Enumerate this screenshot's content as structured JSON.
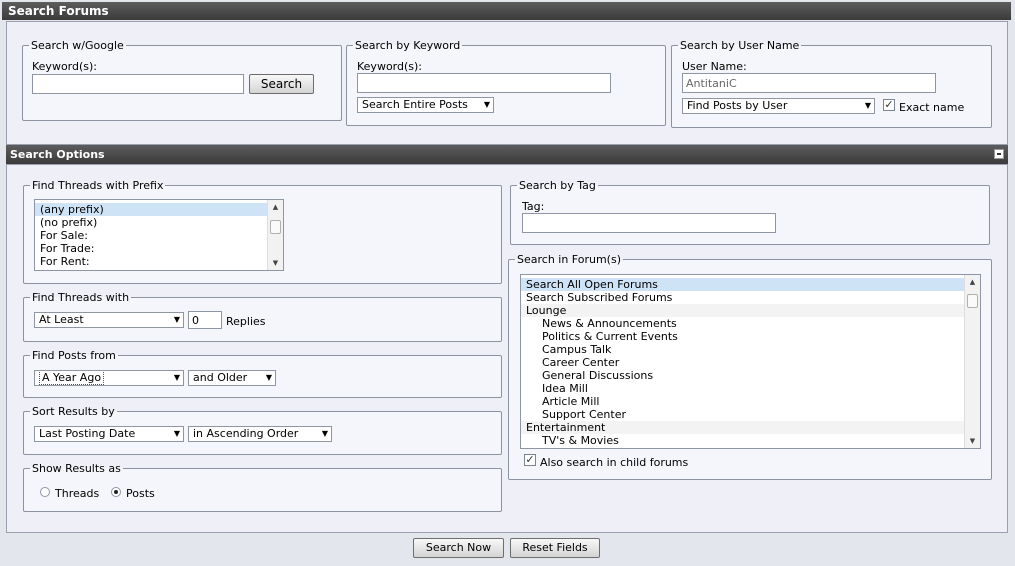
{
  "title": "Search Forums",
  "google": {
    "legend": "Search w/Google",
    "keyword_label": "Keyword(s):",
    "keyword_value": "",
    "search_button": "Search"
  },
  "keyword": {
    "legend": "Search by Keyword",
    "keyword_label": "Keyword(s):",
    "keyword_value": "",
    "scope_select": "Search Entire Posts"
  },
  "username": {
    "legend": "Search by User Name",
    "label": "User Name:",
    "value": "AntitaniC",
    "mode_select": "Find Posts by User",
    "exact_label": "Exact name",
    "exact_checked": true
  },
  "options_title": "Search Options",
  "prefix": {
    "legend": "Find Threads with Prefix",
    "items": [
      "(any prefix)",
      "(no prefix)",
      "For Sale:",
      "For Trade:",
      "For Rent:"
    ]
  },
  "threads_with": {
    "legend": "Find Threads with",
    "select": "At Least",
    "value": "0",
    "suffix": "Replies"
  },
  "posts_from": {
    "legend": "Find Posts from",
    "select": "A Year Ago",
    "age_select": "and Older"
  },
  "sort": {
    "legend": "Sort Results by",
    "field_select": "Last Posting Date",
    "order_select": "in Ascending Order"
  },
  "show_as": {
    "legend": "Show Results as",
    "threads_label": "Threads",
    "posts_label": "Posts",
    "selected": "Posts"
  },
  "tag": {
    "legend": "Search by Tag",
    "label": "Tag:",
    "value": ""
  },
  "forums": {
    "legend": "Search in Forum(s)",
    "items": [
      {
        "label": "Search All Open Forums",
        "indent": false,
        "selected": true
      },
      {
        "label": "Search Subscribed Forums",
        "indent": false
      },
      {
        "label": "Lounge",
        "indent": false
      },
      {
        "label": "News & Announcements",
        "indent": true
      },
      {
        "label": "Politics & Current Events",
        "indent": true
      },
      {
        "label": "Campus Talk",
        "indent": true
      },
      {
        "label": "Career Center",
        "indent": true
      },
      {
        "label": "General Discussions",
        "indent": true
      },
      {
        "label": "Idea Mill",
        "indent": true
      },
      {
        "label": "Article Mill",
        "indent": true
      },
      {
        "label": "Support Center",
        "indent": true
      },
      {
        "label": "Entertainment",
        "indent": false
      },
      {
        "label": "TV's & Movies",
        "indent": true
      }
    ],
    "child_label": "Also search in child forums",
    "child_checked": true
  },
  "buttons": {
    "search_now": "Search Now",
    "reset": "Reset Fields"
  }
}
